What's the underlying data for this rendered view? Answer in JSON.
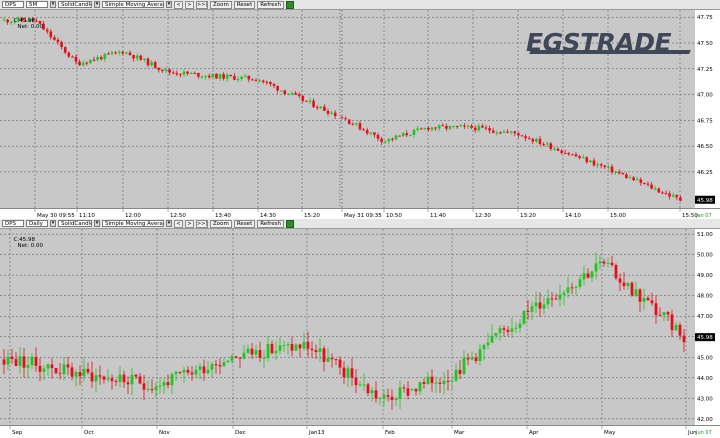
{
  "top_toolbar": {
    "symbol": "DPS",
    "interval": "5M",
    "chart_style": "SolidCandle",
    "study": "Simple Moving Average",
    "nav_prev": "<",
    "nav_next": ">",
    "nav_end": ">>|",
    "zoom": "Zoom",
    "reset": "Reset",
    "refresh": "Refresh"
  },
  "top_header": {
    "close": "C:45.98",
    "net": "Net: 0.00"
  },
  "bottom_toolbar": {
    "symbol": "DPS",
    "interval": "Daily",
    "chart_style": "SolidCandle",
    "study": "Simple Moving Average",
    "nav_prev": "<",
    "nav_next": ">",
    "nav_end": ">>|",
    "zoom": "Zoom",
    "reset": "Reset",
    "refresh": "Refresh"
  },
  "bottom_header": {
    "close": "C:45.98",
    "net": "Net: 0.00"
  },
  "logo": {
    "text": "EGSTRADE"
  },
  "colors": {
    "up": "#22c322",
    "down": "#e0101c",
    "plot_bg": "#c8c8c8",
    "grid": "#505050"
  },
  "chart_data": [
    {
      "type": "candlestick",
      "interval": "5M",
      "ylim": [
        45.9,
        47.82
      ],
      "yticks": [
        46.25,
        46.5,
        46.75,
        47.0,
        47.25,
        47.5,
        47.75
      ],
      "ytick_labels": [
        "46.25",
        "46.50",
        "46.75",
        "47.00",
        "47.25",
        "47.50",
        "47.75"
      ],
      "last_price": "45.98",
      "xticks": [
        "May 30 09:55",
        "11:10",
        "12:00",
        "12:50",
        "13:40",
        "14:30",
        "15:20",
        "May 31 09:35",
        "10:50",
        "11:40",
        "12:30",
        "13:20",
        "14:10",
        "15:00",
        "15:50"
      ],
      "session_break_label": "May 31 09:35",
      "corner_label": "Jan 07",
      "close_path": [
        [
          "May 30 09:55",
          47.72
        ],
        [
          "11:10",
          47.3
        ],
        [
          "12:00",
          47.42
        ],
        [
          "12:50",
          47.22
        ],
        [
          "13:40",
          47.18
        ],
        [
          "14:30",
          47.15
        ],
        [
          "15:20",
          46.95
        ],
        [
          "May 31 09:35",
          46.78
        ],
        [
          "10:50",
          46.55
        ],
        [
          "11:40",
          46.68
        ],
        [
          "12:30",
          46.68
        ],
        [
          "13:20",
          46.62
        ],
        [
          "14:10",
          46.45
        ],
        [
          "15:00",
          46.28
        ],
        [
          "15:50",
          45.98
        ]
      ]
    },
    {
      "type": "candlestick",
      "interval": "Daily",
      "ylim": [
        41.7,
        51.25
      ],
      "yticks": [
        42,
        43,
        44,
        45,
        46,
        47,
        48,
        49,
        50,
        51
      ],
      "ytick_labels": [
        "42.00",
        "43.00",
        "44.00",
        "45.00",
        "46.00",
        "47.00",
        "48.00",
        "49.00",
        "50.00",
        "51.00"
      ],
      "last_price": "45.98",
      "xticks": [
        "Sep",
        "Oct",
        "Nov",
        "Dec",
        "Jan13",
        "Feb",
        "Mar",
        "Apr",
        "May",
        "Jun"
      ],
      "corner_label": "Jun 07",
      "close_path": [
        [
          "Sep",
          44.9
        ],
        [
          "Oct",
          44.2
        ],
        [
          "Nov",
          43.6
        ],
        [
          "Dec",
          45.1
        ],
        [
          "Jan13",
          45.6
        ],
        [
          "Feb",
          42.9
        ],
        [
          "Mar",
          44.2
        ],
        [
          "Apr",
          47.2
        ],
        [
          "May",
          49.6
        ],
        [
          "Jun",
          45.98
        ]
      ]
    }
  ]
}
